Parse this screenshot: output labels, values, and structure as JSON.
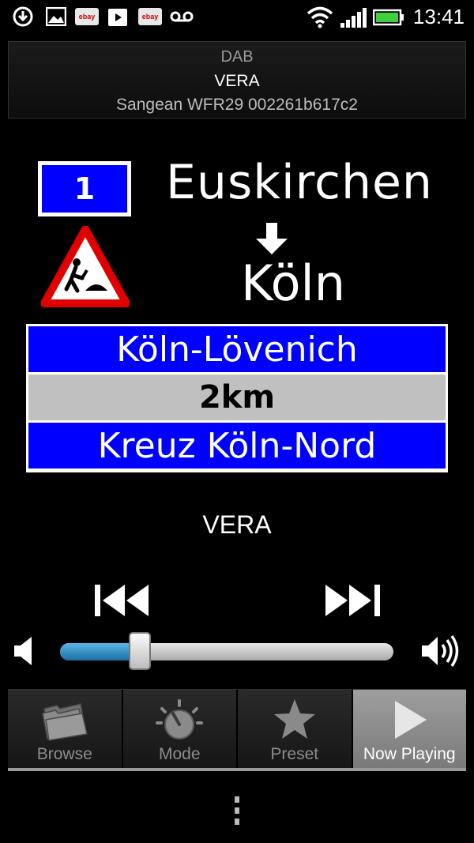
{
  "status_bar": {
    "time": "13:41",
    "left_icons": [
      "download-icon",
      "image-icon",
      "ebay-icon",
      "play-store-icon",
      "ebay-icon",
      "voicemail-icon"
    ],
    "ebay_label": "ebay",
    "right_icons": [
      "wifi-icon",
      "signal-icon",
      "battery-icon"
    ]
  },
  "header": {
    "source": "DAB",
    "station": "VERA",
    "device": "Sangean WFR29 002261b617c2"
  },
  "slideshow": {
    "route_number": "1",
    "destination_top": "Euskirchen",
    "destination_bottom": "Köln",
    "rows": [
      {
        "text": "Köln-Lövenich",
        "style": "blue"
      },
      {
        "text": "2km",
        "style": "grey"
      },
      {
        "text": "Kreuz Köln-Nord",
        "style": "blue"
      }
    ],
    "colors": {
      "sign_blue": "#0000ff",
      "sign_grey": "#c0c0c0",
      "warning_red": "#e00000"
    }
  },
  "now_playing": {
    "title": "VERA"
  },
  "volume": {
    "level": 0.24,
    "accent": "#2a8fcf"
  },
  "tabs": [
    {
      "label": "Browse",
      "icon": "folder-icon",
      "active": false
    },
    {
      "label": "Mode",
      "icon": "mode-dial-icon",
      "active": false
    },
    {
      "label": "Preset",
      "icon": "star-icon",
      "active": false
    },
    {
      "label": "Now Playing",
      "icon": "play-icon",
      "active": true
    }
  ]
}
